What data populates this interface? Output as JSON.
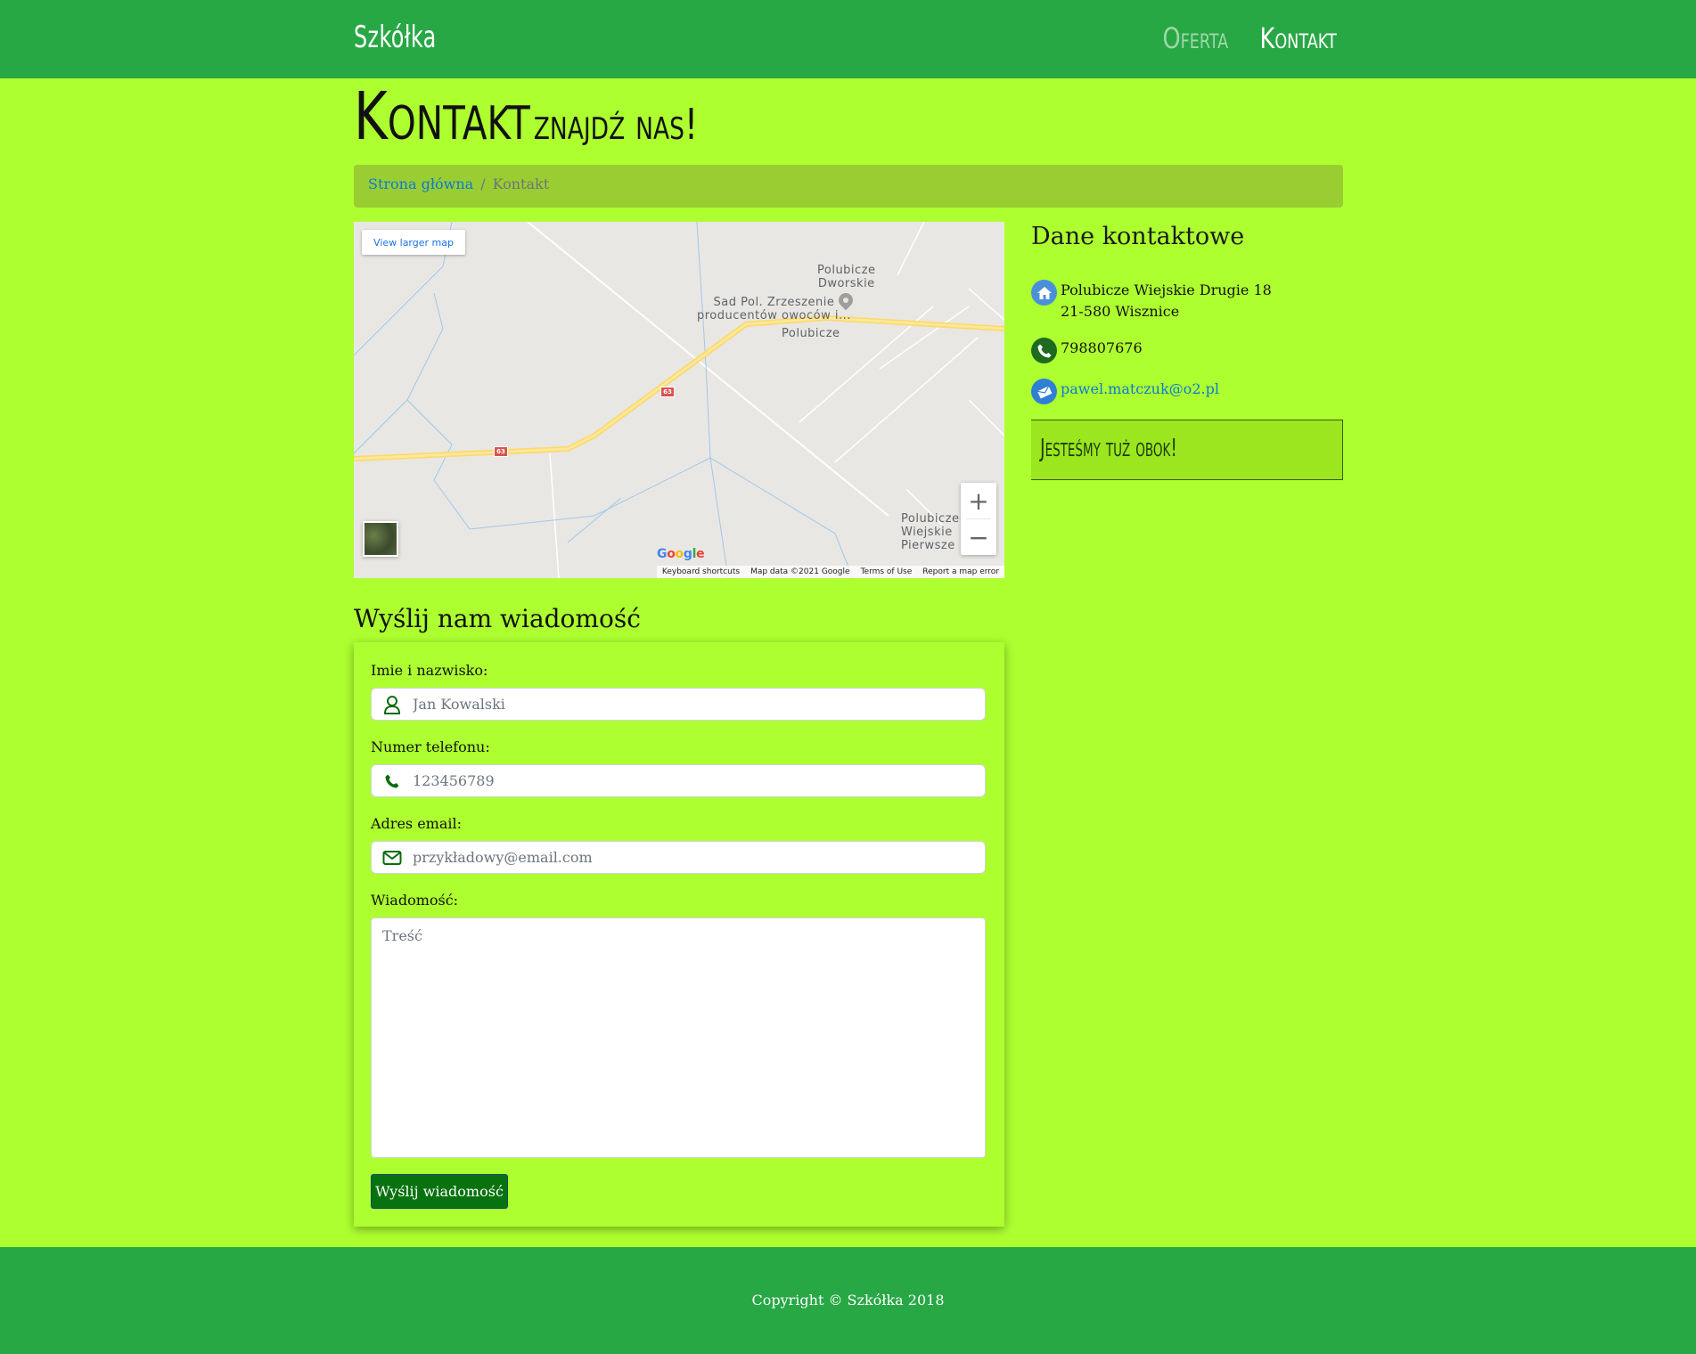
{
  "navbar": {
    "brand": "Szkółka",
    "links": [
      {
        "label": "Oferta",
        "active": false
      },
      {
        "label": "Kontakt",
        "active": true
      }
    ]
  },
  "header": {
    "title": "Kontakt",
    "subtitle": "znajdź nas!"
  },
  "breadcrumb": {
    "home": "Strona główna",
    "separator": "/",
    "current": "Kontakt"
  },
  "map": {
    "larger_map_button": "View larger map",
    "labels": {
      "dworskie": "Polubicze\nDworskie",
      "poi": "Sad Pol. Zrzeszenie\nproducentów owoców i...",
      "polubicze": "Polubicze",
      "pierwsze": "Polubicze\nWiejskie\nPierwsze"
    },
    "road_number": "63",
    "zoom_in": "+",
    "zoom_out": "−",
    "google": "Google",
    "footer": {
      "shortcuts": "Keyboard shortcuts",
      "data": "Map data ©2021 Google",
      "terms": "Terms of Use",
      "report": "Report a map error"
    }
  },
  "contact": {
    "title": "Dane kontaktowe",
    "address_line1": "Polubicze Wiejskie Drugie 18",
    "address_line2": "21-580 Wisznice",
    "phone": "798807676",
    "email": "pawel.matczuk@o2.pl",
    "banner": "Jesteśmy tuż obok!",
    "colors": {
      "home_icon": "#4a90d9",
      "phone_icon": "#1e6b1e",
      "email_icon": "#2f7fd4"
    }
  },
  "form": {
    "title": "Wyślij nam wiadomość",
    "name_label": "Imie i nazwisko:",
    "name_placeholder": "Jan Kowalski",
    "phone_label": "Numer telefonu:",
    "phone_placeholder": "123456789",
    "email_label": "Adres email:",
    "email_placeholder": "przykładowy@email.com",
    "message_label": "Wiadomość:",
    "message_placeholder": "Treść",
    "submit_label": "Wyślij wiadomość"
  },
  "footer": {
    "copyright": "Copyright © Szkółka 2018"
  },
  "colors": {
    "page_bg": "#adff2f",
    "navbar_bg": "#28a745",
    "breadcrumb_bg": "#9acd32",
    "button_bg": "#08720f",
    "link": "#0a7ad6"
  }
}
